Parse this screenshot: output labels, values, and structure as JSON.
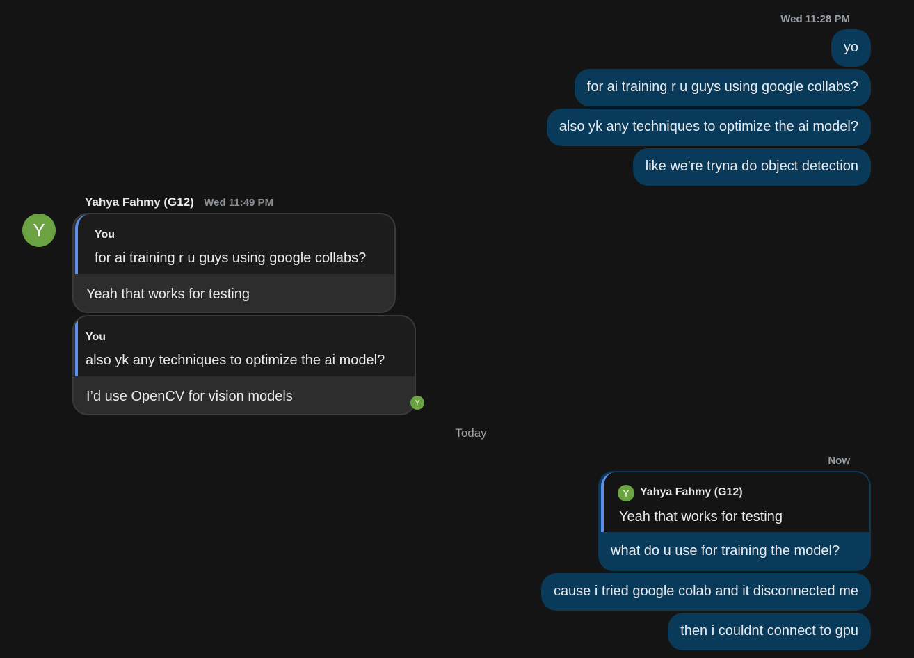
{
  "thread": {
    "group1_time": "Wed 11:28 PM",
    "outgoing_group1": [
      "yo",
      "for ai training r u guys using google collabs?",
      "also yk any techniques to optimize the ai model?",
      "like we're tryna do object detection"
    ],
    "incoming": {
      "avatar_initial": "Y",
      "sender_name": "Yahya Fahmy (G12)",
      "time": "Wed 11:49 PM",
      "messages": [
        {
          "quote_author": "You",
          "quote_text": "for ai training r u guys using google collabs?",
          "reply": "Yeah that works for testing"
        },
        {
          "quote_author": "You",
          "quote_text": "also yk any techniques to optimize the ai model?",
          "reply": "I’d use OpenCV for vision models"
        }
      ],
      "read_receipt_initial": "Y"
    },
    "day_divider": "Today",
    "group2_time": "Now",
    "outgoing_reply": {
      "quote_author_initial": "Y",
      "quote_author": "Yahya Fahmy (G12)",
      "quote_text": "Yeah that works for testing",
      "reply": "what do u use for training the model?"
    },
    "outgoing_group2": [
      "cause i tried google colab and it disconnected me",
      "then i couldnt connect to gpu"
    ]
  },
  "colors": {
    "background": "#141414",
    "outgoing_bubble": "#0a3a5a",
    "incoming_bubble": "#2d2d2d",
    "quote_accent": "#5a8ff0",
    "avatar": "#6ba343"
  }
}
